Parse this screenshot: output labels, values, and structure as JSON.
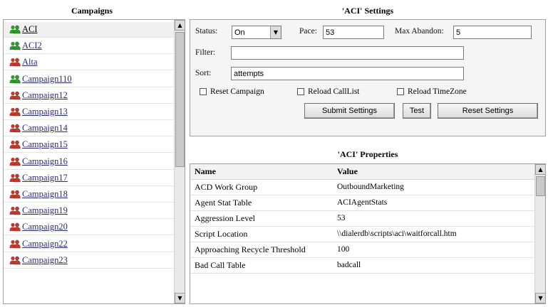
{
  "campaigns_panel": {
    "title": "Campaigns",
    "items": [
      {
        "label": "ACI",
        "status": "active",
        "selected": true
      },
      {
        "label": "ACI2",
        "status": "active",
        "selected": false
      },
      {
        "label": "Alta",
        "status": "inactive",
        "selected": false
      },
      {
        "label": "Campaign110",
        "status": "active",
        "selected": false
      },
      {
        "label": "Campaign12",
        "status": "inactive",
        "selected": false
      },
      {
        "label": "Campaign13",
        "status": "inactive",
        "selected": false
      },
      {
        "label": "Campaign14",
        "status": "inactive",
        "selected": false
      },
      {
        "label": "Campaign15",
        "status": "inactive",
        "selected": false
      },
      {
        "label": "Campaign16",
        "status": "inactive",
        "selected": false
      },
      {
        "label": "Campaign17",
        "status": "inactive",
        "selected": false
      },
      {
        "label": "Campaign18",
        "status": "inactive",
        "selected": false
      },
      {
        "label": "Campaign19",
        "status": "inactive",
        "selected": false
      },
      {
        "label": "Campaign20",
        "status": "inactive",
        "selected": false
      },
      {
        "label": "Campaign22",
        "status": "inactive",
        "selected": false
      },
      {
        "label": "Campaign23",
        "status": "inactive",
        "selected": false
      }
    ]
  },
  "settings": {
    "title": "'ACI' Settings",
    "status_label": "Status:",
    "status_value": "On",
    "pace_label": "Pace:",
    "pace_value": "53",
    "max_abandon_label": "Max Abandon:",
    "max_abandon_value": "5",
    "filter_label": "Filter:",
    "filter_value": "",
    "sort_label": "Sort:",
    "sort_value": "attempts",
    "reset_campaign_label": "Reset Campaign",
    "reload_calllist_label": "Reload CallList",
    "reload_timezone_label": "Reload TimeZone",
    "submit_label": "Submit Settings",
    "test_label": "Test",
    "reset_label": "Reset Settings"
  },
  "properties": {
    "title": "'ACI' Properties",
    "headers": {
      "name": "Name",
      "value": "Value"
    },
    "rows": [
      {
        "name": "ACD Work Group",
        "value": "OutboundMarketing"
      },
      {
        "name": "Agent Stat Table",
        "value": "ACIAgentStats"
      },
      {
        "name": "Aggression Level",
        "value": "53"
      },
      {
        "name": "Script Location",
        "value": "\\\\dialerdb\\scripts\\aci\\waitforcall.htm"
      },
      {
        "name": "Approaching Recycle Threshold",
        "value": "100"
      },
      {
        "name": "Bad Call Table",
        "value": "badcall"
      }
    ]
  },
  "icons": {
    "active_color": "#2e9a2e",
    "inactive_color": "#c0392b",
    "arrow_up": "▲",
    "arrow_down": "▼"
  }
}
